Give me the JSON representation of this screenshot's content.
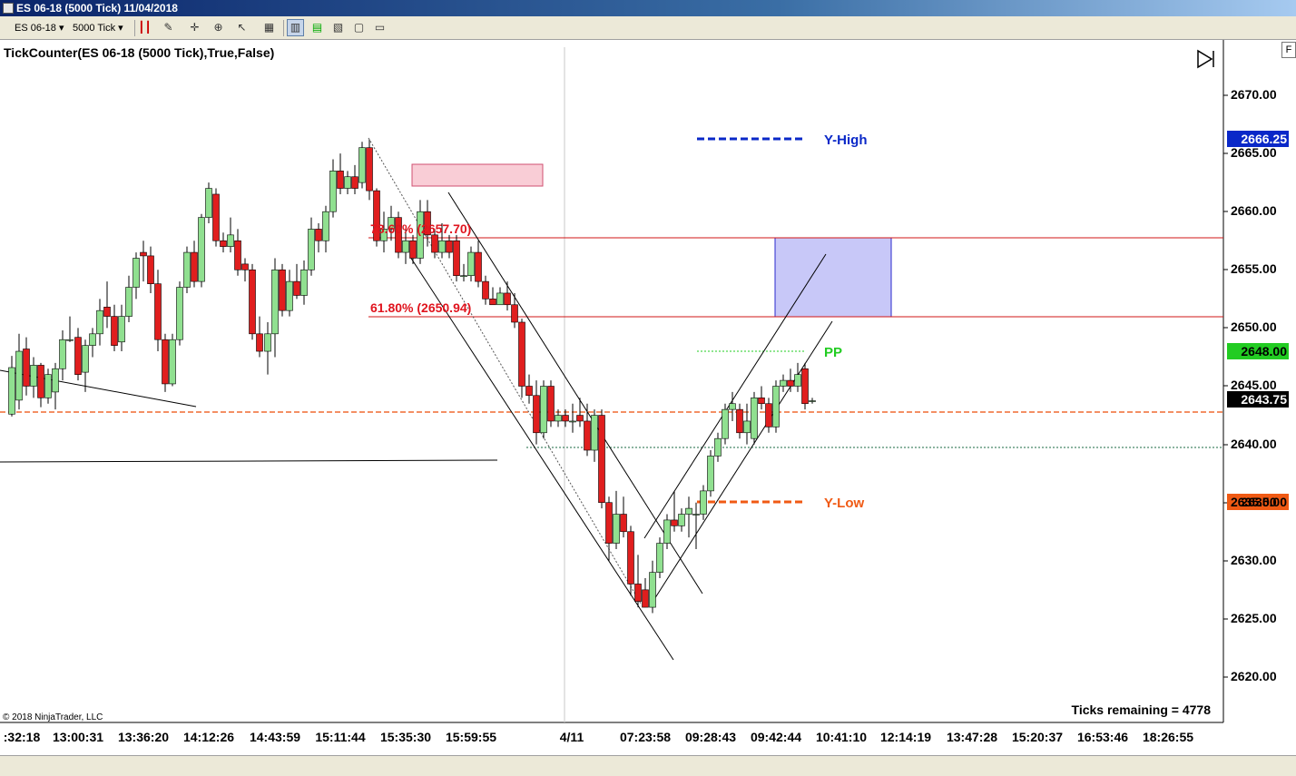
{
  "window": {
    "title": "ES 06-18 (5000 Tick)  11/04/2018"
  },
  "toolbar": {
    "instrument": "ES 06-18",
    "interval": "5000 Tick"
  },
  "indicator_label": "TickCounter(ES 06-18 (5000 Tick),True,False)",
  "ticks_remaining": "Ticks remaining = 4778",
  "copyright": "© 2018 NinjaTrader, LLC",
  "levels": {
    "y_high": {
      "label": "Y-High",
      "price": "2666.25",
      "color": "#0000c8"
    },
    "pp": {
      "label": "PP",
      "price": "2648.00",
      "color": "#22cc22"
    },
    "y_low": {
      "label": "Y-Low",
      "price": "2635.00",
      "color": "#f05a14"
    },
    "last": {
      "price": "2643.75",
      "color": "#000000"
    }
  },
  "fib": {
    "f786": "78.60% (2657.70)",
    "f618": "61.80% (2650.94)"
  },
  "y_axis": [
    "2670.00",
    "2665.00",
    "2660.00",
    "2655.00",
    "2650.00",
    "2645.00",
    "2640.00",
    "2635.00",
    "2630.00",
    "2625.00",
    "2620.00"
  ],
  "x_axis": [
    ":32:18",
    "13:00:31",
    "13:36:20",
    "14:12:26",
    "14:43:59",
    "15:11:44",
    "15:35:30",
    "15:59:55",
    "4/11",
    "07:23:58",
    "09:28:43",
    "09:42:44",
    "10:41:10",
    "12:14:19",
    "13:47:28",
    "15:20:37",
    "16:53:46",
    "18:26:55"
  ],
  "colors": {
    "up": "#90e090",
    "down": "#e01e1e"
  }
}
